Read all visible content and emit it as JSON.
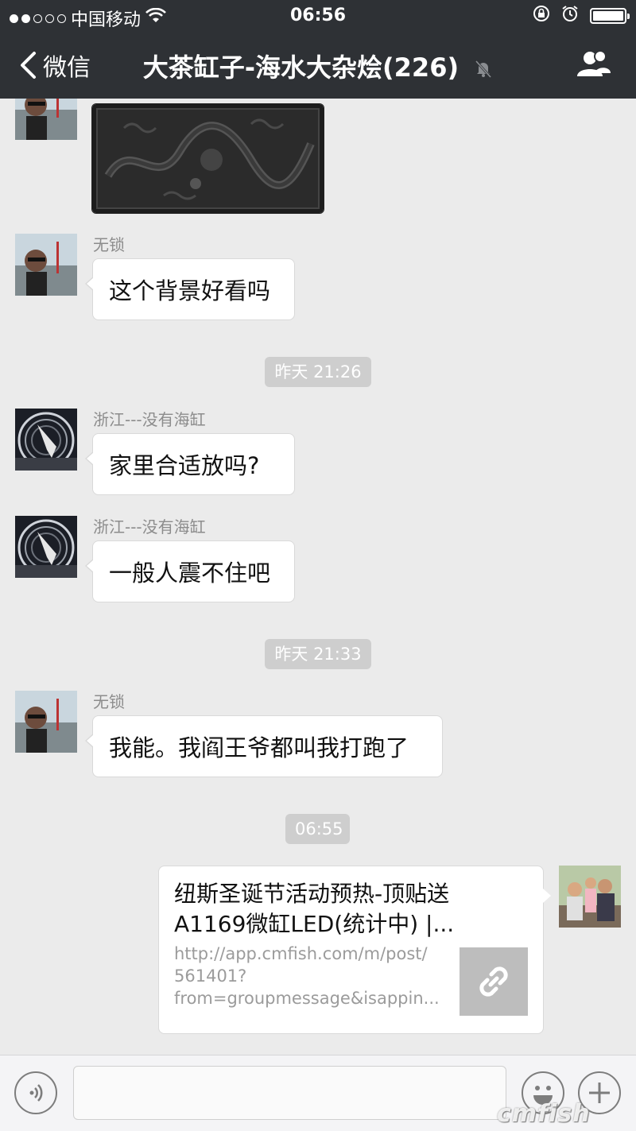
{
  "status_bar": {
    "carrier": "中国移动",
    "time": "06:56",
    "signal_dots_on": 2,
    "signal_dots_total": 5,
    "battery_level": 1.0
  },
  "nav": {
    "back_label": "微信",
    "title": "大茶缸子-海水大杂烩(226)",
    "muted_icon": "bell-off-icon",
    "right_icon": "group-members-icon"
  },
  "messages": {
    "m1": {
      "sender": "无锁",
      "text": "这个背景好看吗"
    },
    "t1": "昨天 21:26",
    "m2": {
      "sender": "浙江---没有海缸",
      "text": "家里合适放吗?"
    },
    "m3": {
      "sender": "浙江---没有海缸",
      "text": "一般人震不住吧"
    },
    "t2": "昨天 21:33",
    "m4": {
      "sender": "无锁",
      "text": "我能。我阎王爷都叫我打跑了"
    },
    "t3": "06:55",
    "link": {
      "title_line1": "纽斯圣诞节活动预热-顶贴送",
      "title_line2": "A1169微缸LED(统计中) |...",
      "url_line1": "http://app.cmfish.com/m/post/",
      "url_line2": "561401?",
      "url_line3": "from=groupmessage&isappin..."
    }
  },
  "input_bar": {
    "voice_icon": "voice-icon",
    "emoji_icon": "emoji-icon",
    "plus_icon": "plus-icon",
    "input_value": ""
  },
  "watermark": "cmfish"
}
